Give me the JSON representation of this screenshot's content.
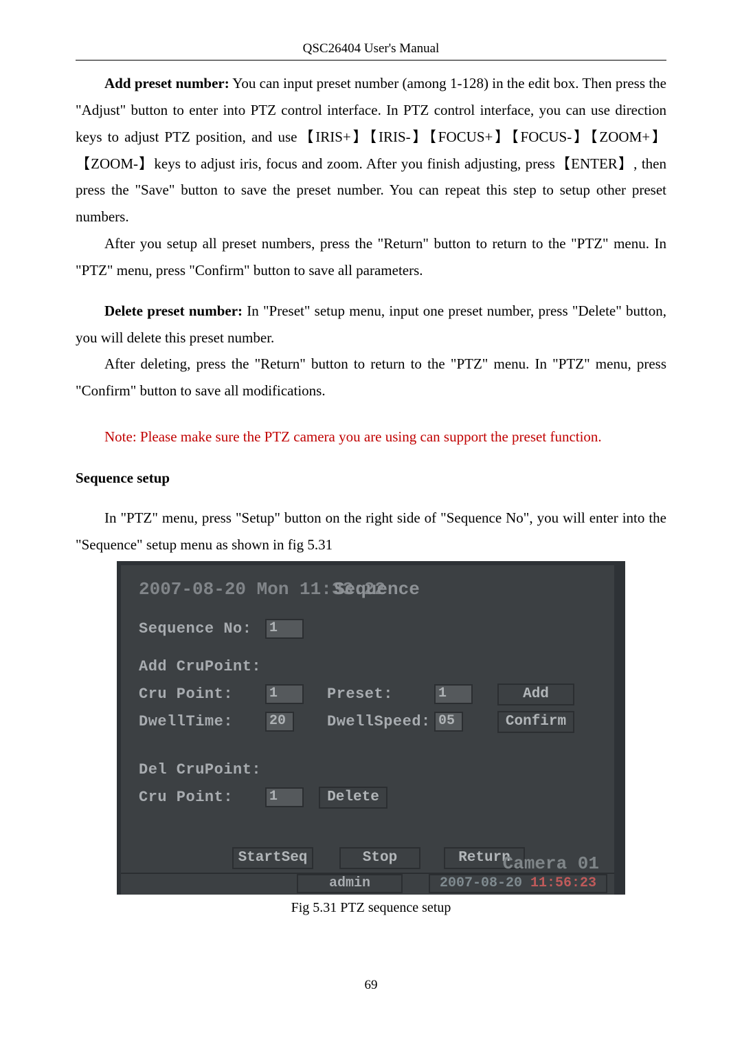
{
  "header": {
    "title": "QSC26404 User's Manual"
  },
  "para": {
    "p1_bold": "Add preset number:",
    "p1": " You can input preset number (among 1-128) in the edit box. Then press the \"Adjust\" button to enter into PTZ control interface. In PTZ control interface, you can use direction keys to adjust PTZ position, and use【IRIS+】【IRIS-】【FOCUS+】【FOCUS-】【ZOOM+】【ZOOM-】keys to adjust iris, focus and zoom. After you finish adjusting, press【ENTER】, then press the \"Save\" button to save the preset number. You can repeat this step to setup other preset numbers.",
    "p2": "After you setup all preset numbers, press the \"Return\" button to return to the \"PTZ\" menu. In \"PTZ\" menu, press \"Confirm\" button to save all parameters.",
    "p3_bold": "Delete preset number:",
    "p3": " In \"Preset\" setup menu, input one preset number, press \"Delete\" button, you will delete this preset number.",
    "p4": "After deleting, press the \"Return\" button to return to the \"PTZ\" menu. In \"PTZ\" menu, press \"Confirm\" button to save all modifications.",
    "note": "Note: Please make sure the PTZ camera you are using can support the preset function.",
    "seq_head": "Sequence setup",
    "p5": "In \"PTZ\" menu, press \"Setup\" button on the right side of \"Sequence No\", you will enter into the \"Sequence\" setup menu as shown in fig 5.31"
  },
  "screen": {
    "date_line": "2007-08-20 Mon 11:33:22",
    "title_overlay": "Sequence",
    "seq_no_label": "Sequence No:",
    "seq_no_val": "1",
    "add_cru_label": "Add CruPoint:",
    "cru_point_label": "Cru Point:",
    "cru_point_val": "1",
    "preset_label": "Preset:",
    "preset_val": "1",
    "add_btn": "Add",
    "dwell_time_label": "DwellTime:",
    "dwell_time_val": "20",
    "dwell_speed_label": "DwellSpeed:",
    "dwell_speed_val": "05",
    "confirm_btn": "Confirm",
    "del_cru_label": "Del CruPoint:",
    "del_cru_point_label": "Cru Point:",
    "del_cru_point_val": "1",
    "delete_btn": "Delete",
    "startseq_btn": "StartSeq",
    "stop_btn": "Stop",
    "return_btn": "Return",
    "camera_ghost": "Camera 01",
    "status_user": "admin",
    "status_time_date": "2007-08-20 ",
    "status_time_time": "11:56:23"
  },
  "caption": "Fig 5.31 PTZ sequence setup",
  "page_number": "69"
}
